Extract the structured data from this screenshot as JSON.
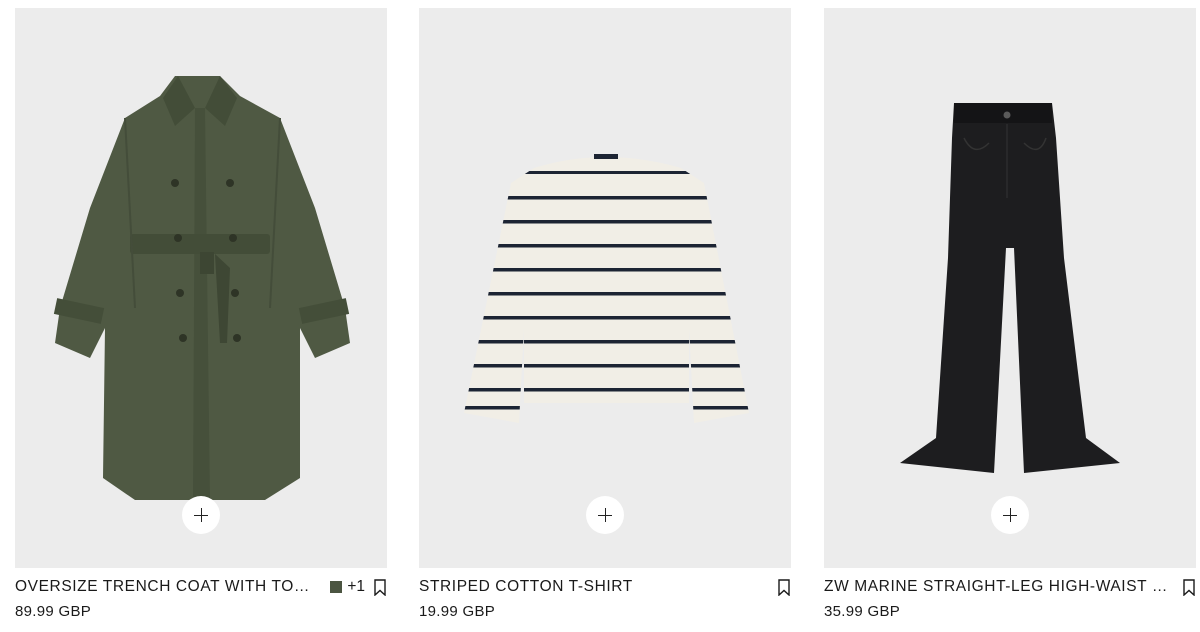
{
  "colors": {
    "tile_background": "#ececec",
    "trench_swatch": "#4b5541"
  },
  "products": [
    {
      "name": "OVERSIZE TRENCH COAT WITH TOPSTITCHING",
      "price": "89.99 GBP",
      "more_colors": "+1",
      "swatch_color": "#4b5541",
      "image_icon": "trench-coat-image"
    },
    {
      "name": "STRIPED COTTON T-SHIRT",
      "price": "19.99 GBP",
      "image_icon": "striped-shirt-image"
    },
    {
      "name": "ZW MARINE STRAIGHT-LEG HIGH-WAIST JEANS",
      "price": "35.99 GBP",
      "image_icon": "black-jeans-image"
    }
  ],
  "icons": {
    "add": "plus-icon",
    "save": "bookmark-icon"
  }
}
